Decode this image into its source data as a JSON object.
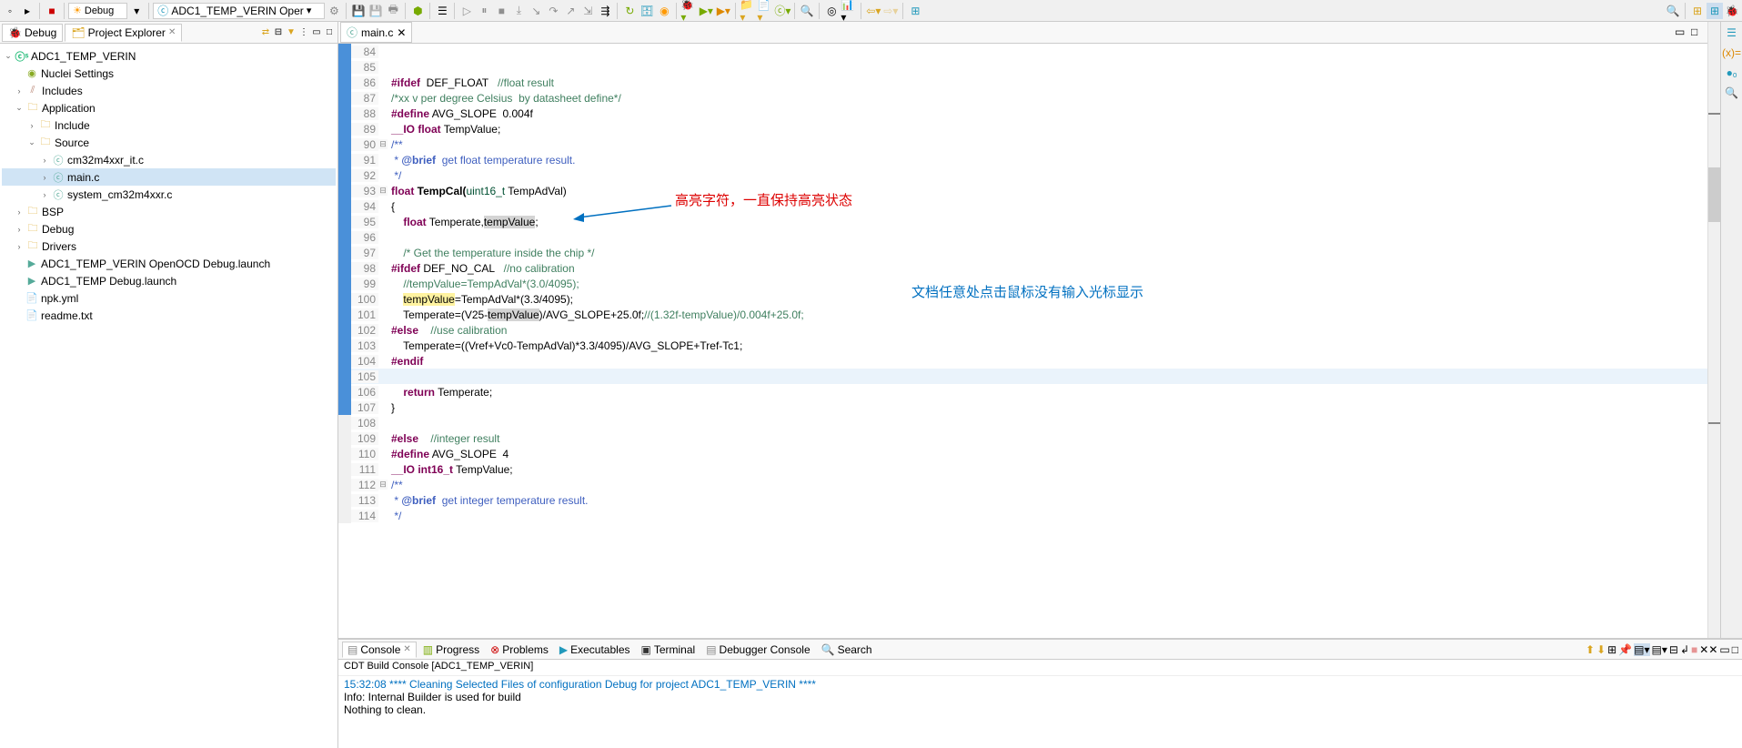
{
  "toolbar": {
    "combo_debug": "Debug",
    "combo_run": "ADC1_TEMP_VERIN Oper"
  },
  "leftTabs": {
    "debug": "Debug",
    "explorer": "Project Explorer"
  },
  "tree": {
    "project": "ADC1_TEMP_VERIN",
    "nuclei": "Nuclei Settings",
    "includes": "Includes",
    "application": "Application",
    "include": "Include",
    "source": "Source",
    "file_it": "cm32m4xxr_it.c",
    "file_main": "main.c",
    "file_sys": "system_cm32m4xxr.c",
    "bsp": "BSP",
    "debug": "Debug",
    "drivers": "Drivers",
    "launch1": "ADC1_TEMP_VERIN OpenOCD Debug.launch",
    "launch2": "ADC1_TEMP Debug.launch",
    "npk": "npk.yml",
    "readme": "readme.txt"
  },
  "editor": {
    "tab": "main.c"
  },
  "annotations": {
    "red": "高亮字符，一直保持高亮状态",
    "blue": "文档任意处点击鼠标没有输入光标显示"
  },
  "code": {
    "l84": "",
    "l85": "",
    "l86": {
      "a": "#ifdef",
      "b": "  DEF_FLOAT   ",
      "c": "//float result"
    },
    "l87": "/*xx v per degree Celsius  by datasheet define*/",
    "l88": {
      "a": "#define",
      "b": " AVG_SLOPE  0.004f"
    },
    "l89": {
      "a": "__IO float",
      "b": " TempValue;"
    },
    "l90": "/**",
    "l91": {
      "a": " * ",
      "b": "@brief",
      "c": "  get float temperature result."
    },
    "l92": " */",
    "l93": {
      "a": "float",
      "b": " TempCal(",
      "c": "uint16_t",
      "d": " TempAdVal)"
    },
    "l94": "{",
    "l95": {
      "a": "    ",
      "b": "float",
      "c": " Temperate,",
      "d": "tempValue",
      "e": ";"
    },
    "l96": "",
    "l97": "    /* Get the temperature inside the chip */",
    "l98": {
      "a": "#ifdef",
      "b": " DEF_NO_CAL   ",
      "c": "//no calibration"
    },
    "l99": "    //tempValue=TempAdVal*(3.0/4095);",
    "l100": {
      "a": "    ",
      "b": "tempValue",
      "c": "=TempAdVal*(3.3/4095);"
    },
    "l101": {
      "a": "    Temperate=(V25-",
      "b": "tempValue",
      "c": ")/AVG_SLOPE+25.0f;",
      "d": "//(1.32f-tempValue)/0.004f+25.0f;"
    },
    "l102": {
      "a": "#else",
      "b": "    ",
      "c": "//use calibration"
    },
    "l103": "    Temperate=((Vref+Vc0-TempAdVal)*3.3/4095)/AVG_SLOPE+Tref-Tc1;",
    "l104": "#endif",
    "l105": "",
    "l106": {
      "a": "    ",
      "b": "return",
      "c": " Temperate;"
    },
    "l107": "}",
    "l108": "",
    "l109": {
      "a": "#else",
      "b": "    ",
      "c": "//integer result"
    },
    "l110": {
      "a": "#define",
      "b": " AVG_SLOPE  4"
    },
    "l111": {
      "a": "__IO int16_t",
      "b": " TempValue;"
    },
    "l112": "/**",
    "l113": {
      "a": " * ",
      "b": "@brief",
      "c": "  get integer temperature result."
    },
    "l114": " */"
  },
  "lineNumbers": [
    "84",
    "85",
    "86",
    "87",
    "88",
    "89",
    "90",
    "91",
    "92",
    "93",
    "94",
    "95",
    "96",
    "97",
    "98",
    "99",
    "100",
    "101",
    "102",
    "103",
    "104",
    "105",
    "106",
    "107",
    "108",
    "109",
    "110",
    "111",
    "112",
    "113",
    "114"
  ],
  "consoleTabs": {
    "console": "Console",
    "progress": "Progress",
    "problems": "Problems",
    "executables": "Executables",
    "terminal": "Terminal",
    "debugger": "Debugger Console",
    "search": "Search"
  },
  "consoleHeader": "CDT Build Console [ADC1_TEMP_VERIN]",
  "consoleBody": {
    "l1": "15:32:08 **** Cleaning Selected Files of configuration Debug for project ADC1_TEMP_VERIN ****",
    "l2": "Info: Internal Builder is used for build",
    "l3": "Nothing to clean."
  }
}
